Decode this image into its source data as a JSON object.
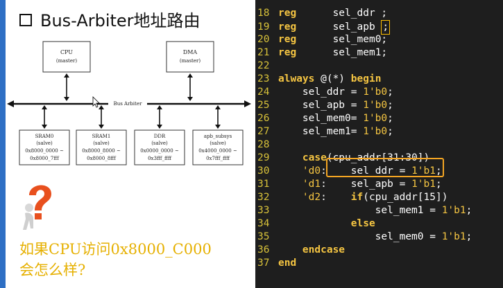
{
  "slide": {
    "title": "Bus-Arbiter地址路由",
    "question_line1": "如果CPU访问0x8000_C000",
    "question_line2": "会怎么样?"
  },
  "diagram": {
    "masters": [
      {
        "name": "CPU",
        "role": "(master)"
      },
      {
        "name": "DMA",
        "role": "(master)"
      }
    ],
    "bus_label": "Bus Arbiter",
    "slaves": [
      {
        "name": "SRAM0",
        "role": "(salve)",
        "addr1": "0x8000_0000 ~",
        "addr2": "0x8000_7fff"
      },
      {
        "name": "SRAM1",
        "role": "(salve)",
        "addr1": "0x8000_8000 ~",
        "addr2": "0x8000_8fff"
      },
      {
        "name": "DDR",
        "role": "(salve)",
        "addr1": "0x0000_0000 ~",
        "addr2": "0x3fff_ffff"
      },
      {
        "name": "apb_subsys",
        "role": "(salve)",
        "addr1": "0x4000_0000 ~",
        "addr2": "0x7fff_ffff"
      }
    ]
  },
  "code": {
    "lines": [
      {
        "num": "18",
        "kw": "reg",
        "text": "      sel_ddr ;"
      },
      {
        "num": "19",
        "kw": "reg",
        "text": "      sel_apb ",
        "cursor": ";"
      },
      {
        "num": "20",
        "kw": "reg",
        "text": "      sel_mem0;"
      },
      {
        "num": "21",
        "kw": "reg",
        "text": "      sel_mem1;"
      },
      {
        "num": "22",
        "kw": "",
        "text": ""
      },
      {
        "num": "23",
        "kw": "always",
        "text": " @(*) ",
        "kw2": "begin"
      },
      {
        "num": "24",
        "kw": "",
        "text": "    sel_ddr = ",
        "val": "1'b0",
        "tail": ";"
      },
      {
        "num": "25",
        "kw": "",
        "text": "    sel_apb = ",
        "val": "1'b0",
        "tail": ";"
      },
      {
        "num": "26",
        "kw": "",
        "text": "    sel_mem0= ",
        "val": "1'b0",
        "tail": ";"
      },
      {
        "num": "27",
        "kw": "",
        "text": "    sel_mem1= ",
        "val": "1'b0",
        "tail": ";"
      },
      {
        "num": "28",
        "kw": "",
        "text": ""
      },
      {
        "num": "29",
        "pre": "    ",
        "kw": "case",
        "text": "(cpu_addr[31:30])"
      },
      {
        "num": "30",
        "pre": "    ",
        "kw": "",
        "val0": "'d0",
        "text": ":    sel_ddr = ",
        "val": "1'b1",
        "tail": ";"
      },
      {
        "num": "31",
        "pre": "    ",
        "kw": "",
        "val0": "'d1",
        "text": ":    sel_apb = ",
        "val": "1'b1",
        "tail": ";"
      },
      {
        "num": "32",
        "pre": "    ",
        "kw": "",
        "val0": "'d2",
        "text": ":    ",
        "kw2": "if",
        "text2": "(cpu_addr[15])"
      },
      {
        "num": "33",
        "kw": "",
        "text": "                sel_mem1 = ",
        "val": "1'b1",
        "tail": ";"
      },
      {
        "num": "34",
        "pre": "            ",
        "kw": "else",
        "text": ""
      },
      {
        "num": "35",
        "kw": "",
        "text": "                sel_mem0 = ",
        "val": "1'b1",
        "tail": ";"
      },
      {
        "num": "36",
        "pre": "    ",
        "kw": "endcase",
        "text": ""
      },
      {
        "num": "37",
        "kw": "end",
        "text": ""
      }
    ]
  },
  "colors": {
    "keyword": "#f5c542",
    "code_bg": "#1e1e1e",
    "question_text": "#e6b000",
    "highlight_box": "#f5a623"
  }
}
